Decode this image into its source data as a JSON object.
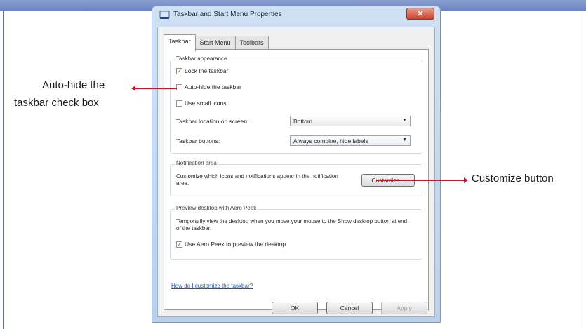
{
  "window": {
    "title": "Taskbar and Start Menu Properties",
    "close_glyph": "✕"
  },
  "tabs": [
    "Taskbar",
    "Start Menu",
    "Toolbars"
  ],
  "taskbar_appearance": {
    "title": "Taskbar appearance",
    "lock_label": "Lock the taskbar",
    "lock_checked": true,
    "autohide_label": "Auto-hide the taskbar",
    "autohide_checked": false,
    "small_icons_label": "Use small icons",
    "small_icons_checked": false,
    "location_label": "Taskbar location on screen:",
    "location_value": "Bottom",
    "buttons_label": "Taskbar buttons:",
    "buttons_value": "Always combine, hide labels"
  },
  "notification_area": {
    "title": "Notification area",
    "description": "Customize which icons and notifications appear in the notification area.",
    "customize_label": "Customize..."
  },
  "aero_peek": {
    "title": "Preview desktop with Aero Peek",
    "description": "Temporarily view the desktop when you move your mouse to the Show desktop button at end of the taskbar.",
    "use_peek_label": "Use Aero Peek to preview the desktop",
    "use_peek_checked": true
  },
  "help_link": "How do I customize the taskbar?",
  "footer": {
    "ok_label": "OK",
    "cancel_label": "Cancel",
    "apply_label": "Apply"
  },
  "annotations": {
    "autohide_callout_line1": "Auto-hide the",
    "autohide_callout_line2": "taskbar check box",
    "customize_callout": "Customize button"
  },
  "colors": {
    "callout_line": "#c0182a",
    "link": "#1a55b8"
  },
  "icons": {
    "check": "✓",
    "dropdown": "▼"
  }
}
